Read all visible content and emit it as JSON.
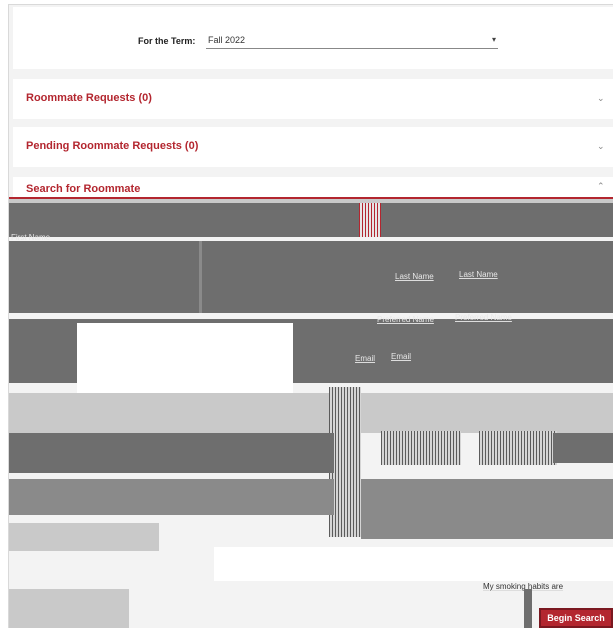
{
  "term": {
    "label": "For the Term:",
    "value": "Fall 2022"
  },
  "sections": {
    "roommate_requests": "Roommate Requests (0)",
    "pending_requests": "Pending Roommate Requests (0)",
    "search": "Search for Roommate"
  },
  "form": {
    "first_name_label": "First Name",
    "last_name_label": "Last Name",
    "last_name_value": "Last Name",
    "preferred_name_label": "Preferred Name",
    "preferred_name_value": "Preferred Name",
    "email_label": "Email",
    "email_value": "Email",
    "smoking_label": "My smoking habits are"
  },
  "actions": {
    "begin_search": "Begin Search"
  },
  "colors": {
    "accent": "#b3262f"
  }
}
